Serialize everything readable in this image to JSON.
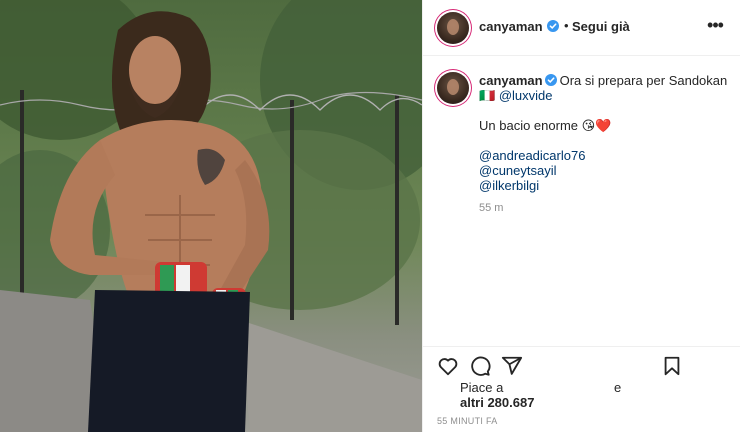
{
  "colors": {
    "text": "#262626",
    "link": "#00376b",
    "muted": "#8e8e8e",
    "verified": "#3897f0",
    "story_ring": "#d62976"
  },
  "post": {
    "header": {
      "username": "canyaman",
      "separator": "•",
      "follow_label": "Segui già",
      "more_icon": "ellipsis-icon"
    },
    "caption": {
      "username": "canyaman",
      "text_part1": "Ora si prepara per Sandokan",
      "flag": "🇮🇹",
      "mention": "@luxvide",
      "line2": "Un bacio enorme 😘❤️",
      "tags": [
        "@andreadicarlo76",
        "@cuneytsayil",
        "@ilkerbilgi"
      ],
      "time": "55 m"
    },
    "actions": {
      "like_icon": "heart-icon",
      "comment_icon": "comment-icon",
      "share_icon": "share-icon",
      "save_icon": "bookmark-icon"
    },
    "likes": {
      "line1": "Piace a",
      "conjunction": "e",
      "line2": "altri 280.687"
    },
    "posted_ago": "55 MINUTI FA"
  }
}
